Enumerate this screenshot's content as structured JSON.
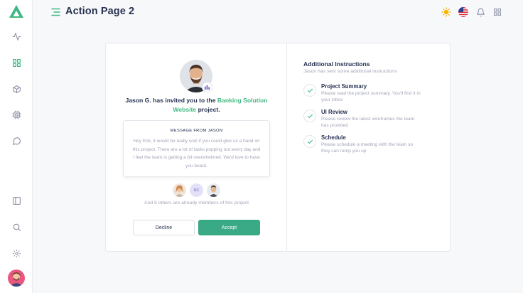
{
  "app": {
    "page_title": "Action Page 2"
  },
  "colors": {
    "accent": "#41b883",
    "accept_button": "#3aa986",
    "title_text": "#283252",
    "muted_text": "#a2a5b9"
  },
  "sidebar": {
    "icons": [
      "activity-icon",
      "grid-icon",
      "box-icon",
      "cpu-icon",
      "message-circle-icon",
      "sidebar-panel-icon",
      "search-icon",
      "settings-icon"
    ]
  },
  "topbar": {
    "icons": [
      "sun-icon",
      "us-flag-icon",
      "bell-icon",
      "apps-grid-icon"
    ]
  },
  "invite": {
    "inviter": "Jason G.",
    "text_pre": "has invited you to the",
    "project": "Banking Solution Website",
    "text_post": "project."
  },
  "message": {
    "title": "MESSAGE FROM JASON",
    "body": "Hey Erik, it would be really cool if you could give us a hand on this project. There are a lot of tasks popping out every day and I feel the team is getting a bit overwhelmed. We'd love to have you board."
  },
  "members": {
    "initials": "SC",
    "note": "And 5 others are already members of this project"
  },
  "actions": {
    "decline": "Decline",
    "accept": "Accept"
  },
  "instructions": {
    "title": "Additional Instructions",
    "subtitle": "Jason has sent some additional instructions",
    "tasks": [
      {
        "title": "Project Summary",
        "desc": "Please read the project summary. You'll find it in your inbox"
      },
      {
        "title": "UI Review",
        "desc": "Please review the latest wireframes the team has provided"
      },
      {
        "title": "Schedule",
        "desc": "Please schedule a meeting with the team so they can ramp you up"
      }
    ]
  }
}
